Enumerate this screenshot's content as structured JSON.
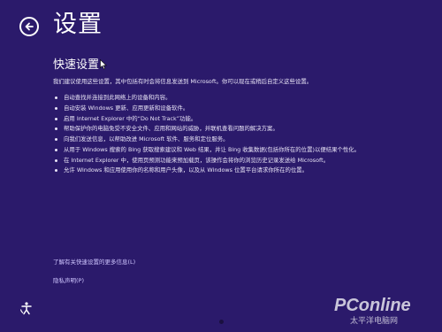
{
  "header": {
    "back_icon": "back-arrow-icon",
    "title": "设置"
  },
  "section": {
    "title": "快速设置",
    "intro": "我们建议使用这些设置，其中包括有时会将信息发送到 Microsoft。你可以现在或稍后自定义这些设置。"
  },
  "bullets": [
    "自动查找并连接到此网络上的设备和内容。",
    "自动安装 Windows 更新、应用更新和设备软件。",
    "启用 Internet Explorer 中的“Do Not Track”功能。",
    "帮助保护你的电脑免受不安全文件、应用和网站的威胁，并联机查看问题的解决方案。",
    "向我们发送信息，以帮助改进 Microsoft 软件、服务和定位服务。",
    "从用于 Windows 搜索的 Bing 获取搜索建议和 Web 结果，并让 Bing 收集数据(包括你所在的位置)以便结果个性化。",
    "在 Internet Explorer 中，使用页预测功能来预加载页，该操作会将你的浏览历史记录发送给 Microsoft。",
    "允许 Windows 和应用使用你的名称和用户头像，以及从 Windows 位置平台请求你所在的位置。"
  ],
  "links": {
    "more_info": "了解有关快速设置的更多信息(L)",
    "privacy": "隐私声明(P)"
  },
  "footer": {
    "ease_of_access_icon": "ease-of-access-icon"
  },
  "watermark": {
    "brand": "PConline",
    "sub": "太平洋电脑网"
  },
  "colors": {
    "background": "#2b1a6b",
    "text": "#ffffff",
    "link": "#cfc6ff"
  }
}
